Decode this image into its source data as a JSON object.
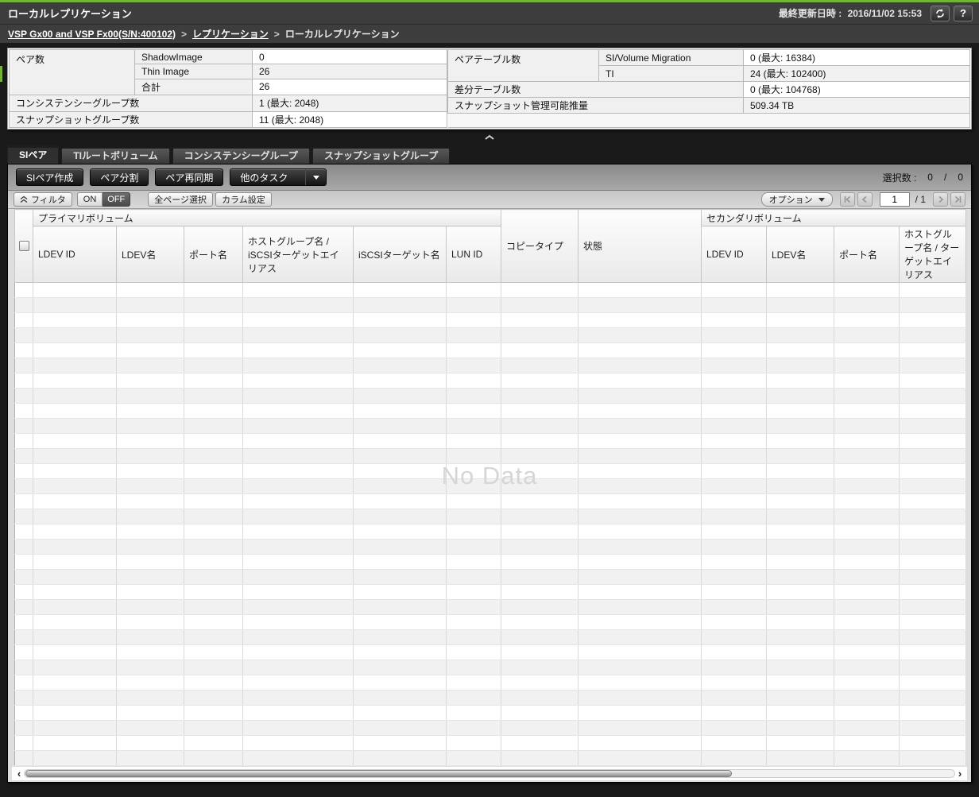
{
  "accent_green": "#6eb92b",
  "titlebar": {
    "title": "ローカルレプリケーション",
    "updated_label": "最終更新日時 :",
    "updated_value": "2016/11/02 15:53",
    "help_glyph": "?"
  },
  "breadcrumb": {
    "separator": ">",
    "items": [
      {
        "label": "VSP Gx00 and VSP Fx00(S/N:400102)",
        "link": true
      },
      {
        "label": "レプリケーション",
        "link": true
      },
      {
        "label": "ローカルレプリケーション",
        "link": false
      }
    ]
  },
  "summary": {
    "pair_count_label": "ペア数",
    "shadowimage_label": "ShadowImage",
    "shadowimage_value": "0",
    "thinimage_label": "Thin Image",
    "thinimage_value": "26",
    "total_label": "合計",
    "total_value": "26",
    "cons_group_label": "コンシステンシーグループ数",
    "cons_group_value": "1 (最大: 2048)",
    "snap_group_label": "スナップショットグループ数",
    "snap_group_value": "11 (最大: 2048)",
    "pair_table_label": "ペアテーブル数",
    "si_vm_label": "SI/Volume Migration",
    "si_vm_value": "0 (最大: 16384)",
    "ti_label": "TI",
    "ti_value": "24 (最大: 102400)",
    "diff_table_label": "差分テーブル数",
    "diff_table_value": "0 (最大: 104768)",
    "snap_capacity_label": "スナップショット管理可能推量",
    "snap_capacity_value": "509.34 TB"
  },
  "tabs": [
    {
      "id": "si-pair",
      "label": "SIペア",
      "active": true
    },
    {
      "id": "ti-root-volume",
      "label": "TIルートボリューム",
      "active": false
    },
    {
      "id": "consistency-group",
      "label": "コンシステンシーグループ",
      "active": false
    },
    {
      "id": "snapshot-group",
      "label": "スナップショットグループ",
      "active": false
    }
  ],
  "toolbar": {
    "create_si_pair": "SIペア作成",
    "split_pair": "ペア分割",
    "resync_pair": "ペア再同期",
    "more_tasks": "他のタスク",
    "selection_label": "選択数 :",
    "selection_current": "0",
    "selection_separator": "/",
    "selection_total": "0"
  },
  "filterbar": {
    "filter_label": "フィルタ",
    "on_label": "ON",
    "off_label": "OFF",
    "select_all_pages": "全ページ選択",
    "column_settings": "カラム設定",
    "options_label": "オプション",
    "page_value": "1",
    "page_total": "/ 1"
  },
  "table": {
    "group_primary": "プライマリボリューム",
    "col_copy_type": "コピータイプ",
    "col_status": "状態",
    "group_secondary": "セカンダリボリューム",
    "primary_cols": [
      "LDEV ID",
      "LDEV名",
      "ポート名",
      "ホストグループ名 / iSCSIターゲットエイリアス",
      "iSCSIターゲット名",
      "LUN ID"
    ],
    "secondary_cols": [
      "LDEV ID",
      "LDEV名",
      "ポート名",
      "ホストグループ名 / ターゲットエイリアス"
    ],
    "no_data": "No Data"
  }
}
